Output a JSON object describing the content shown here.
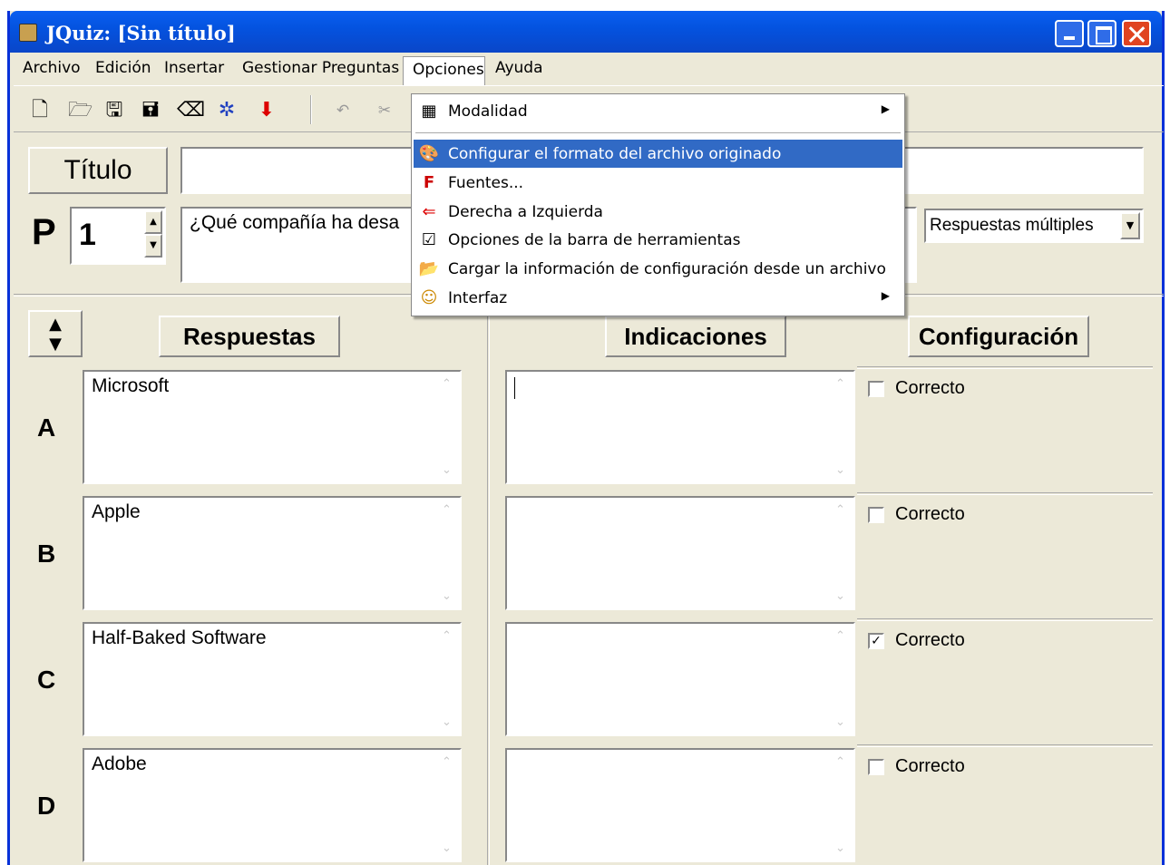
{
  "window": {
    "title": "JQuiz: [Sin título]"
  },
  "menubar": {
    "items": [
      "Archivo",
      "Edición",
      "Insertar",
      "Gestionar Preguntas",
      "Opciones",
      "Ayuda"
    ]
  },
  "toolbar": {
    "icons": [
      "new-file-icon",
      "open-folder-icon",
      "save-icon",
      "save-as-icon",
      "eraser-icon",
      "web-export-icon",
      "hot-potatoes-icon",
      "undo-icon",
      "cut-icon"
    ]
  },
  "form": {
    "title_label": "Título",
    "title_value": "",
    "question_label": "P",
    "question_number": "1",
    "question_text": "¿Qué compañía ha desa",
    "question_type": "Respuestas múltiples"
  },
  "headers": {
    "answers": "Respuestas",
    "feedback": "Indicaciones",
    "settings": "Configuración"
  },
  "answers": [
    {
      "letter": "A",
      "text": "Microsoft",
      "feedback": "",
      "correct_label": "Correcto",
      "checked": false
    },
    {
      "letter": "B",
      "text": "Apple",
      "feedback": "",
      "correct_label": "Correcto",
      "checked": false
    },
    {
      "letter": "C",
      "text": "Half-Baked Software",
      "feedback": "",
      "correct_label": "Correcto",
      "checked": true
    },
    {
      "letter": "D",
      "text": "Adobe",
      "feedback": "",
      "correct_label": "Correcto",
      "checked": false
    }
  ],
  "options_menu": {
    "items": [
      {
        "label": "Modalidad",
        "icon": "modality-icon",
        "submenu": true,
        "highlighted": false
      },
      {
        "label": "Configurar el formato del archivo originado",
        "icon": "configure-format-icon",
        "submenu": false,
        "highlighted": true
      },
      {
        "label": "Fuentes...",
        "icon": "fonts-icon",
        "submenu": false,
        "highlighted": false
      },
      {
        "label": "Derecha a Izquierda",
        "icon": "rtl-icon",
        "submenu": false,
        "highlighted": false
      },
      {
        "label": "Opciones de la barra de herramientas",
        "icon": "toolbar-options-icon",
        "submenu": false,
        "highlighted": false
      },
      {
        "label": "Cargar la información de configuración desde un archivo",
        "icon": "load-config-icon",
        "submenu": false,
        "highlighted": false
      },
      {
        "label": "Interfaz",
        "icon": "interface-icon",
        "submenu": true,
        "highlighted": false
      }
    ]
  }
}
